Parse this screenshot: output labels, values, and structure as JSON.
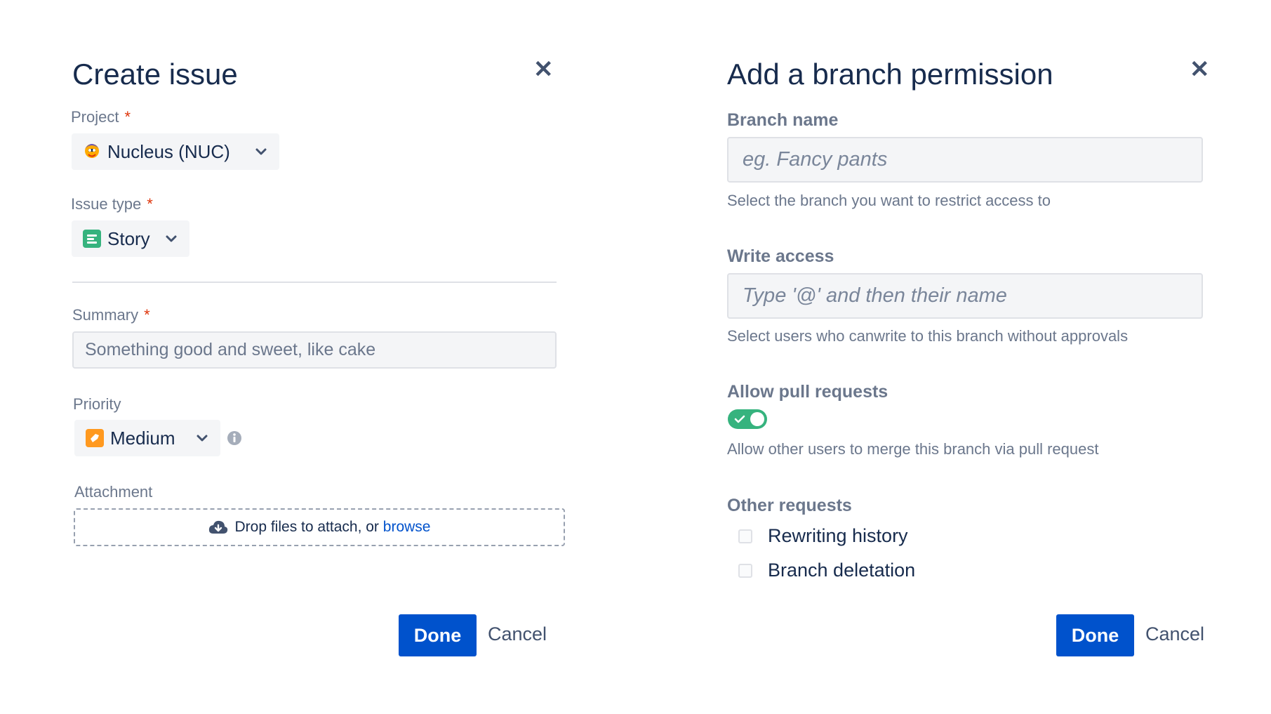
{
  "create_issue": {
    "title": "Create issue",
    "close_icon": "close-icon",
    "project": {
      "label": "Project",
      "required_mark": "*",
      "value": "Nucleus (NUC)",
      "icon": "project-avatar-icon"
    },
    "issue_type": {
      "label": "Issue type",
      "required_mark": "*",
      "value": "Story",
      "icon": "story-icon",
      "icon_color": "#36B37E"
    },
    "summary": {
      "label": "Summary",
      "required_mark": "*",
      "placeholder": "Something good and sweet, like cake"
    },
    "priority": {
      "label": "Priority",
      "value": "Medium",
      "icon": "priority-medium-icon",
      "icon_color": "#FF991F",
      "info_icon": "info-icon"
    },
    "attachment": {
      "label": "Attachment",
      "text": "Drop files to attach, or",
      "link": "browse",
      "icon": "cloud-upload-icon"
    },
    "done_label": "Done",
    "cancel_label": "Cancel"
  },
  "branch_permission": {
    "title": "Add a branch permission",
    "close_icon": "close-icon",
    "branch_name": {
      "label": "Branch name",
      "placeholder": "eg. Fancy pants",
      "help": "Select the branch you want to restrict access to"
    },
    "write_access": {
      "label": "Write access",
      "placeholder": "Type '@' and then their name",
      "help": "Select users who canwrite to this branch without approvals"
    },
    "pull_requests": {
      "label": "Allow pull requests",
      "enabled": true,
      "help": "Allow other users to merge this branch via pull request"
    },
    "other_requests": {
      "label": "Other requests",
      "options": [
        {
          "label": "Rewriting history",
          "checked": false
        },
        {
          "label": "Branch deletation",
          "checked": false
        }
      ]
    },
    "done_label": "Done",
    "cancel_label": "Cancel"
  },
  "colors": {
    "primary": "#0052CC",
    "text": "#172B4D",
    "subtle": "#6B778C",
    "success": "#36B37E",
    "required": "#DE350B"
  }
}
